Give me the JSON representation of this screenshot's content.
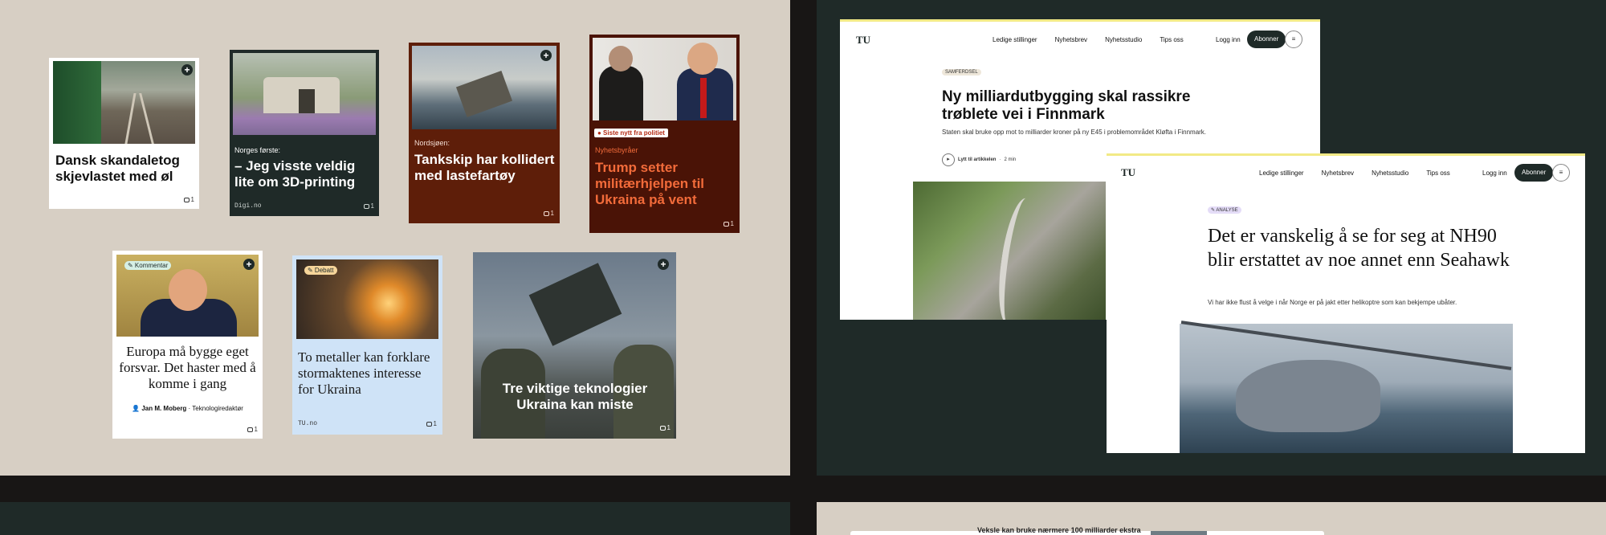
{
  "cards": {
    "c1": {
      "title": "Dansk skandaletog skjevlastet med øl",
      "comments": "1"
    },
    "c2": {
      "kicker": "Norges første:",
      "title": "– Jeg visste veldig lite om 3D-printing",
      "source": "Digi.no",
      "comments": "1"
    },
    "c3": {
      "kicker": "Nordsjøen:",
      "title": "Tankskip har kollidert med lastefartøy",
      "comments": "1"
    },
    "c4": {
      "badge": "● Siste nytt fra politiet",
      "kicker": "Nyhetsbyråer",
      "title": "Trump setter militærhjelpen til Ukraina på vent",
      "comments": "1"
    },
    "c5": {
      "tag": "✎ Kommentar",
      "title": "Europa må bygge eget forsvar. Det haster med å komme i gang",
      "author": "Jan M. Moberg",
      "role": "Teknologiredaktør",
      "comments": "1"
    },
    "c6": {
      "tag": "✎ Debatt",
      "title": "To metaller kan forklare stormaktenes interesse for Ukraina",
      "source": "TU.no",
      "comments": "1"
    },
    "c7": {
      "title": "Tre viktige teknologier Ukraina kan miste",
      "comments": "1"
    }
  },
  "site": {
    "logo": "TU",
    "nav": [
      "Ledige stillinger",
      "Nyhetsbrev",
      "Nyhetsstudio",
      "Tips oss"
    ],
    "login": "Logg inn",
    "subscribe": "Abonner",
    "menu_icon": "≡"
  },
  "article1": {
    "section": "SAMFERDSEL",
    "headline": "Ny milliardutbygging skal rassikre trøblete vei i Finnmark",
    "lede": "Staten skal bruke opp mot to milliarder kroner på ny E45 i problemområdet Kløfta i Finnmark.",
    "listen": "Lytt til artikkelen",
    "duration": "2 min"
  },
  "article2": {
    "section": "✎ ANALYSE",
    "headline": "Det er vanskelig å se for seg at NH90 blir erstattet av noe annet enn Seahawk",
    "lede": "Vi har ikke flust å velge i når Norge er på jakt etter helikoptre som kan bekjempe ubåter."
  },
  "bottom_teaser": "Veksle kan bruke nærmere 100 milliarder ekstra",
  "colors": {
    "cream": "#d7cfc4",
    "dark_green": "#1f2a28",
    "rust": "#5e1e09",
    "accent_orange": "#f26b3a",
    "light_blue": "#cfe3f7",
    "yellow_bar": "#f2ea86"
  }
}
